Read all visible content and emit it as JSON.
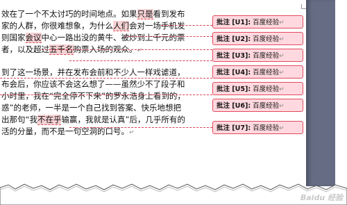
{
  "document": {
    "paragraph1": [
      "效在了一个不太讨巧的时间地点。如果只是看到发布",
      "家的人群，你很难想象，为什么人们会对一场手机发",
      "则国家会议中心一路出没的黄牛、被炒到上千元的票",
      "者，以及超过五千名购票入场的观众。"
    ],
    "paragraph2": [
      "到了这一场景，并在发布会前和不少人一样戏谑道，",
      "布会后，你应该不会这么想了——虽然少不了段子和",
      "小时里，我在“完全停不下来”的罗永浩身上看到的，",
      "惑”的老师，一半是一个自己找到答案、快乐地想把",
      "出那句“我不在乎输赢，我就是认真”后，几乎所有的",
      "活的分量，而不是一句空洞的口号。"
    ]
  },
  "comments": [
    {
      "tag": "批注 [U1]:",
      "text": "百度经验"
    },
    {
      "tag": "批注 [U2]:",
      "text": "百度经验"
    },
    {
      "tag": "批注 [U3]:",
      "text": "百度经验"
    },
    {
      "tag": "批注 [U4]:",
      "text": "百度经验"
    },
    {
      "tag": "批注 [U5]:",
      "text": "百度经验"
    },
    {
      "tag": "批注 [U6]:",
      "text": "百度经验"
    },
    {
      "tag": "批注 [U7]:",
      "text": "百度经验"
    }
  ],
  "paragraph_mark": "↵",
  "watermark": "Baidu 经验",
  "colors": {
    "comment_fill": "#ffd9df",
    "comment_border": "#e34a5e",
    "highlight": "#f6d2d4",
    "dark_panel": "#656c84"
  }
}
